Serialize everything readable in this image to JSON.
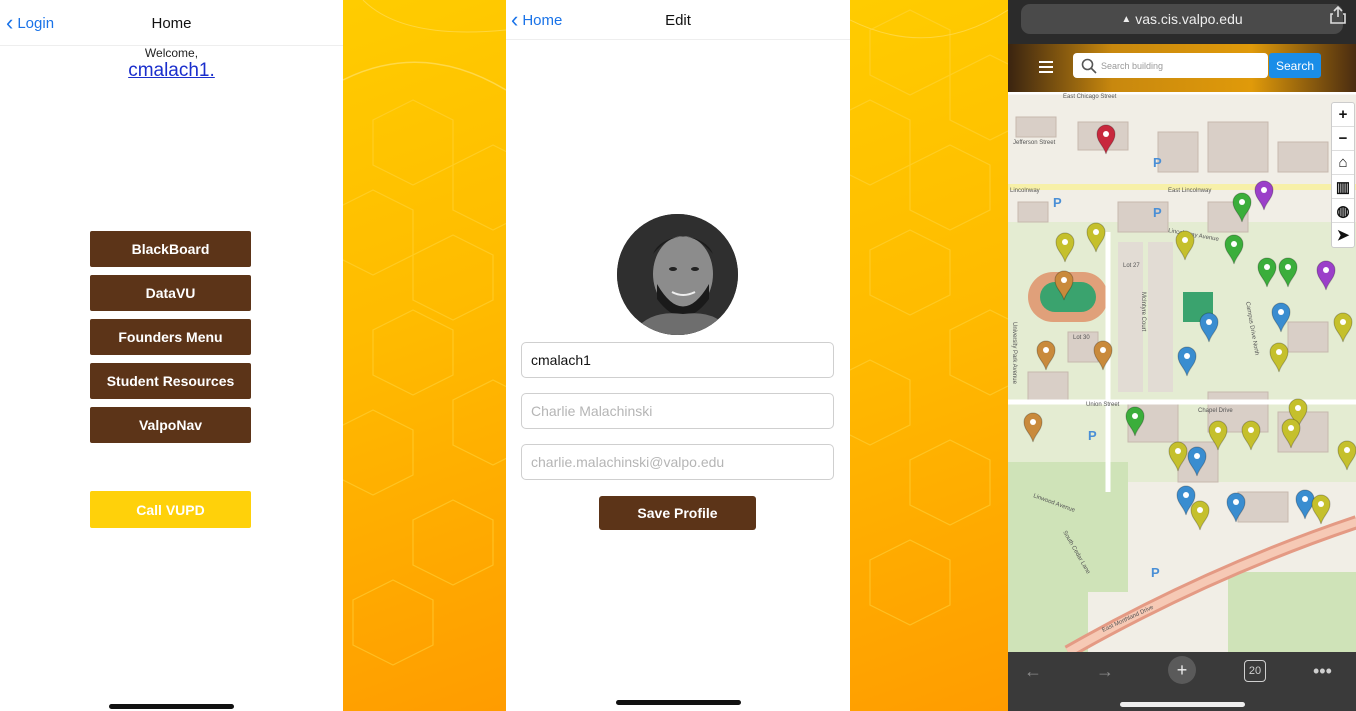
{
  "home_screen": {
    "nav": {
      "back_label": "Login",
      "title": "Home"
    },
    "welcome_text": "Welcome,",
    "username": "cmalach1.",
    "menu_buttons": [
      "BlackBoard",
      "DataVU",
      "Founders Menu",
      "Student Resources",
      "ValpoNav"
    ],
    "call_button": "Call VUPD"
  },
  "edit_screen": {
    "nav": {
      "back_label": "Home",
      "title": "Edit"
    },
    "username_value": "cmalach1",
    "name_placeholder": "Charlie Malachinski",
    "email_placeholder": "charlie.malachinski@valpo.edu",
    "save_button": "Save Profile"
  },
  "map_screen": {
    "url": "vas.cis.valpo.edu",
    "search_placeholder": "Search building",
    "search_button": "Search",
    "map_controls": [
      "+",
      "−",
      "home-icon",
      "map-icon",
      "globe-icon",
      "locate-icon"
    ],
    "street_labels": [
      "East Chicago Street",
      "Jefferson Street",
      "Lincolnway",
      "East Lincolnway",
      "Lot 27",
      "Lot 30",
      "Union Street",
      "Chapel Drive",
      "Campus Drive North",
      "McIntyre Court",
      "University Park Avenue",
      "Linwood Avenue",
      "South Cedar Lane",
      "East Morthland Drive",
      "Lincolnway Avenue"
    ],
    "tab_count": "20",
    "toolbar": [
      "back-arrow-icon",
      "forward-arrow-icon",
      "new-tab-icon",
      "tabs-icon",
      "more-icon"
    ]
  },
  "colors": {
    "brown": "#5c3418",
    "gold": "#ffd10a",
    "link_blue": "#1a73e8",
    "search_blue": "#1a8de8"
  }
}
